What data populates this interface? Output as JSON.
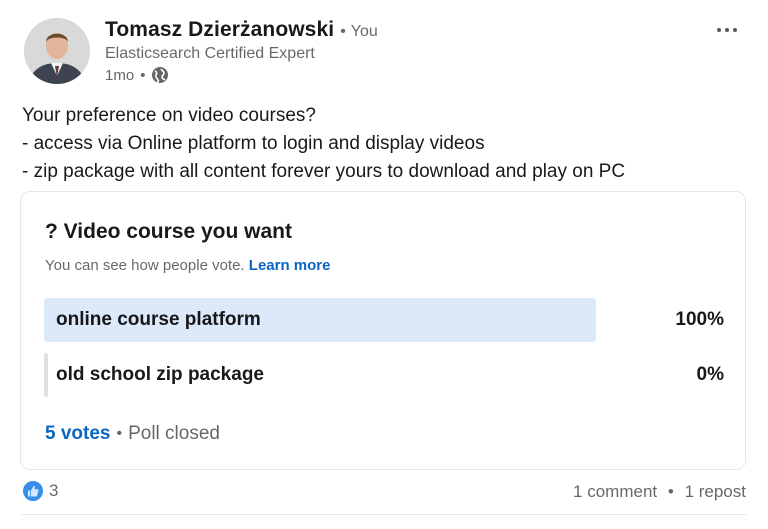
{
  "author": {
    "name": "Tomasz Dzierżanowski",
    "relation": "You",
    "headline": "Elasticsearch Certified Expert",
    "time": "1mo",
    "visibility_icon": "globe-icon"
  },
  "post": {
    "lines": [
      "Your preference on video courses?",
      "- access via Online platform to login and display videos",
      "- zip package with all content forever yours to download and play on PC"
    ]
  },
  "poll": {
    "question": "? Video course you want",
    "note": "You can see how people vote.",
    "learn_more": "Learn more",
    "options": [
      {
        "label": "online course platform",
        "percent_text": "100%",
        "percent": 100
      },
      {
        "label": "old school zip package",
        "percent_text": "0%",
        "percent": 0
      }
    ],
    "votes_text": "5 votes",
    "status": "Poll closed"
  },
  "social": {
    "reaction_icon": "like-icon",
    "reaction_count": "3",
    "comments": "1 comment",
    "reposts": "1 repost"
  },
  "colors": {
    "accent": "#0a66c2",
    "poll_fill_winner": "#dbe9fb",
    "poll_fill_other": "#e0e0e0"
  }
}
